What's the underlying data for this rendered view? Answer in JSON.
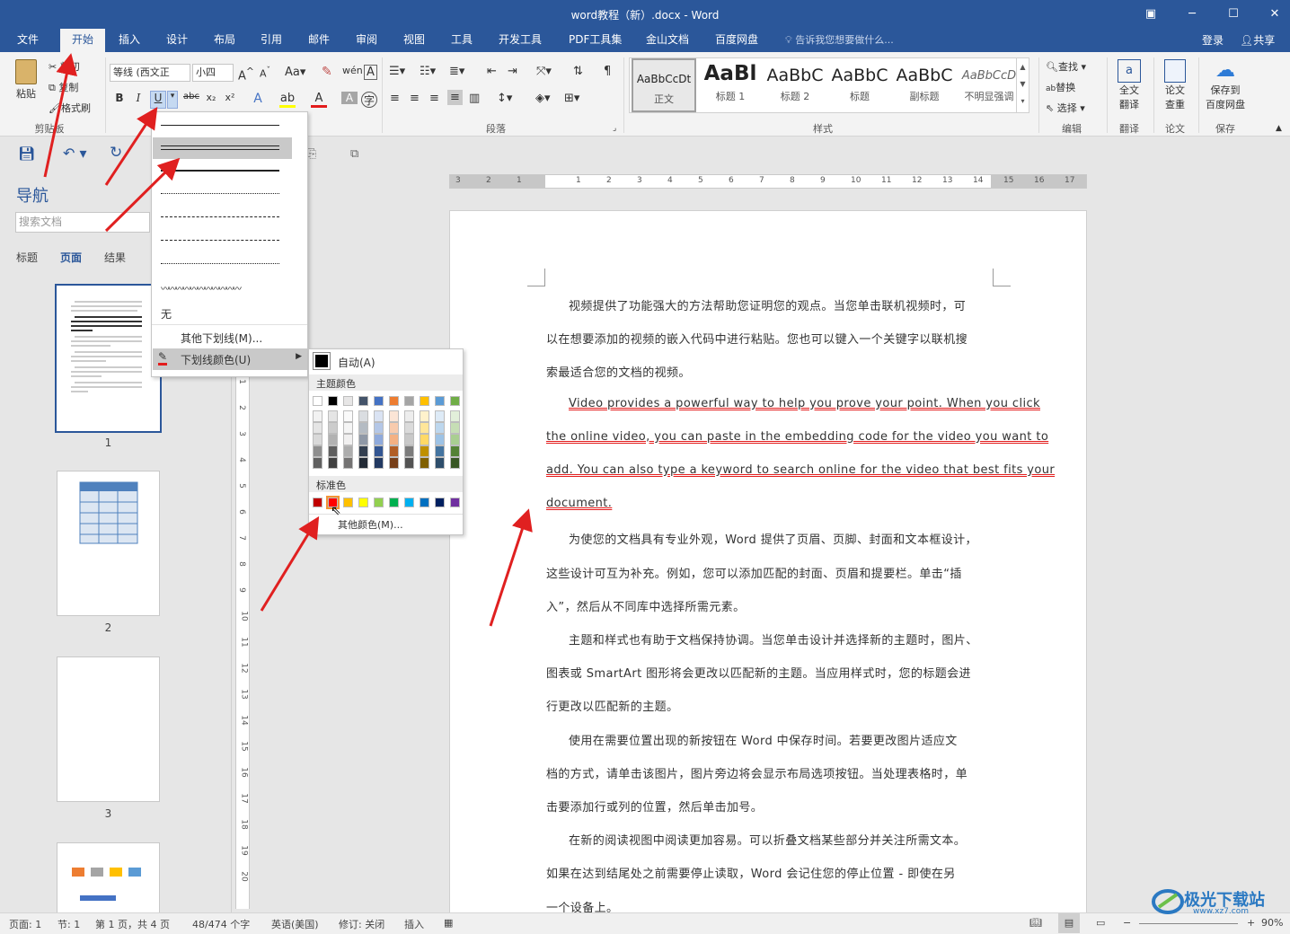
{
  "window": {
    "title": "word教程（新）.docx - Word"
  },
  "tabs": [
    "文件",
    "开始",
    "插入",
    "设计",
    "布局",
    "引用",
    "邮件",
    "审阅",
    "视图",
    "工具",
    "开发工具",
    "PDF工具集",
    "金山文档",
    "百度网盘"
  ],
  "active_tab": "开始",
  "tell_me": "告诉我您想要做什么...",
  "account": {
    "login": "登录",
    "share": "共享"
  },
  "clipboard": {
    "paste": "粘贴",
    "cut": "剪切",
    "copy": "复制",
    "format_painter": "格式刷",
    "label": "剪贴板"
  },
  "font": {
    "name": "等线 (西文正文)",
    "name_display": "等线 (西文正",
    "size": "小四"
  },
  "paragraph_label": "段落",
  "styles": {
    "label": "样式",
    "items": [
      {
        "sample": "AaBbCcDt",
        "name": "正文"
      },
      {
        "sample": "AaBl",
        "name": "标题 1"
      },
      {
        "sample": "AaBbC",
        "name": "标题 2"
      },
      {
        "sample": "AaBbC",
        "name": "标题"
      },
      {
        "sample": "AaBbC",
        "name": "副标题"
      },
      {
        "sample": "AaBbCcD",
        "name": "不明显强调"
      }
    ]
  },
  "editing": {
    "find": "查找",
    "replace": "替换",
    "select": "选择",
    "label": "编辑"
  },
  "translate": {
    "full": "全文翻译",
    "full_l1": "全文",
    "full_l2": "翻译",
    "label": "翻译"
  },
  "paper": {
    "check_l1": "论文",
    "check_l2": "查重",
    "label": "论文"
  },
  "save_baidu": {
    "l1": "保存到",
    "l2": "百度网盘",
    "label": "保存"
  },
  "navigation": {
    "title": "导航",
    "search_placeholder": "搜索文档",
    "tabs": [
      "标题",
      "页面",
      "结果"
    ],
    "active": "页面",
    "pages": [
      "1",
      "2",
      "3"
    ]
  },
  "underline_menu": {
    "none": "无",
    "more": "其他下划线(M)...",
    "color": "下划线颜色(U)"
  },
  "color_menu": {
    "auto": "自动(A)",
    "theme_label": "主题颜色",
    "standard_label": "标准色",
    "more": "其他颜色(M)...",
    "theme_top": [
      "#ffffff",
      "#000000",
      "#e7e6e6",
      "#44546a",
      "#4472c4",
      "#ed7d31",
      "#a5a5a5",
      "#ffc000",
      "#5b9bd5",
      "#70ad47"
    ],
    "standard": [
      "#c00000",
      "#ff0000",
      "#ffc000",
      "#ffff00",
      "#92d050",
      "#00b050",
      "#00b0f0",
      "#0070c0",
      "#002060",
      "#7030a0"
    ]
  },
  "document": {
    "lines": [
      {
        "text": "视频提供了功能强大的方法帮助您证明您的观点。当您单击联机视频时，可",
        "indent": true,
        "ul": false
      },
      {
        "text": "以在想要添加的视频的嵌入代码中进行粘贴。您也可以键入一个关键字以联机搜",
        "indent": false,
        "ul": false
      },
      {
        "text": "索最适合您的文档的视频。",
        "indent": false,
        "ul": false
      },
      {
        "text": "Video provides a powerful way to help you prove your point. When you click",
        "indent": true,
        "ul": true
      },
      {
        "text": "the online video, you can paste in the embedding code for the video you want to",
        "indent": false,
        "ul": true
      },
      {
        "text": "add. You can also type a keyword to search online for the video that best fits your",
        "indent": false,
        "ul": true
      },
      {
        "text": "document.",
        "indent": false,
        "ul": true
      },
      {
        "text": "为使您的文档具有专业外观，Word 提供了页眉、页脚、封面和文本框设计，",
        "indent": true,
        "ul": false
      },
      {
        "text": "这些设计可互为补充。例如，您可以添加匹配的封面、页眉和提要栏。单击“插",
        "indent": false,
        "ul": false
      },
      {
        "text": "入”，然后从不同库中选择所需元素。",
        "indent": false,
        "ul": false
      },
      {
        "text": "主题和样式也有助于文档保持协调。当您单击设计并选择新的主题时，图片、",
        "indent": true,
        "ul": false
      },
      {
        "text": "图表或 SmartArt 图形将会更改以匹配新的主题。当应用样式时，您的标题会进",
        "indent": false,
        "ul": false
      },
      {
        "text": "行更改以匹配新的主题。",
        "indent": false,
        "ul": false
      },
      {
        "text": "使用在需要位置出现的新按钮在 Word 中保存时间。若要更改图片适应文",
        "indent": true,
        "ul": false
      },
      {
        "text": "档的方式，请单击该图片，图片旁边将会显示布局选项按钮。当处理表格时，单",
        "indent": false,
        "ul": false
      },
      {
        "text": "击要添加行或列的位置，然后单击加号。",
        "indent": false,
        "ul": false
      },
      {
        "text": "在新的阅读视图中阅读更加容易。可以折叠文档某些部分并关注所需文本。",
        "indent": true,
        "ul": false
      },
      {
        "text": "如果在达到结尾处之前需要停止读取，Word 会记住您的停止位置 - 即使在另",
        "indent": false,
        "ul": false
      },
      {
        "text": "一个设备上。",
        "indent": false,
        "ul": false
      }
    ]
  },
  "status": {
    "page": "页面: 1",
    "section": "节: 1",
    "pages": "第 1 页，共 4 页",
    "words": "48/474 个字",
    "language": "英语(美国)",
    "track": "修订: 关闭",
    "mode": "插入",
    "zoom": "90%"
  },
  "ruler_numbers": [
    "3",
    "2",
    "1",
    "1",
    "2",
    "3",
    "4",
    "5",
    "6",
    "7",
    "8",
    "9",
    "10",
    "11",
    "12",
    "13",
    "14",
    "15",
    "16",
    "17"
  ],
  "vruler_numbers": [
    "1",
    "2",
    "3",
    "4",
    "5",
    "6",
    "7",
    "8",
    "9",
    "10",
    "11",
    "12",
    "13",
    "14",
    "15",
    "16",
    "17",
    "18",
    "19",
    "20"
  ],
  "watermark": {
    "text": "极光下载站",
    "url": "www.xz7.com"
  },
  "colors": {
    "brand": "#2b579a",
    "accent_red": "#e31c1c",
    "arrow": "#e02020"
  }
}
